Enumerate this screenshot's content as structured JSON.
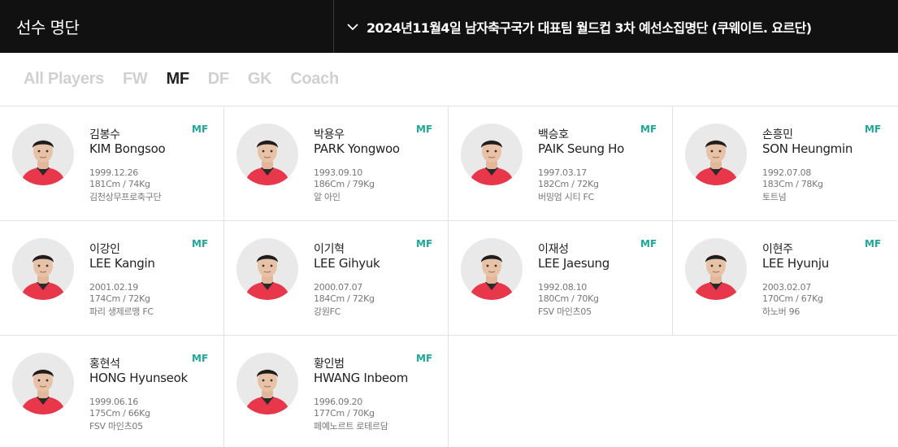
{
  "header": {
    "title": "선수 명단",
    "selection": "2024년11월4일 남자축구국가 대표팀 월드컵 3차 예선소집명단 (쿠웨이트. 요르단)"
  },
  "filters": [
    {
      "label": "All Players",
      "active": false
    },
    {
      "label": "FW",
      "active": false
    },
    {
      "label": "MF",
      "active": true
    },
    {
      "label": "DF",
      "active": false
    },
    {
      "label": "GK",
      "active": false
    },
    {
      "label": "Coach",
      "active": false
    }
  ],
  "players": [
    {
      "name_ko": "김봉수",
      "name_en": "KIM Bongsoo",
      "position": "MF",
      "dob": "1999.12.26",
      "height_weight": "181Cm / 74Kg",
      "club": "김천상무프로축구단"
    },
    {
      "name_ko": "박용우",
      "name_en": "PARK Yongwoo",
      "position": "MF",
      "dob": "1993.09.10",
      "height_weight": "186Cm / 79Kg",
      "club": "알 아인"
    },
    {
      "name_ko": "백승호",
      "name_en": "PAIK Seung Ho",
      "position": "MF",
      "dob": "1997.03.17",
      "height_weight": "182Cm / 72Kg",
      "club": "버밍엄 시티 FC"
    },
    {
      "name_ko": "손흥민",
      "name_en": "SON Heungmin",
      "position": "MF",
      "dob": "1992.07.08",
      "height_weight": "183Cm / 78Kg",
      "club": "토트넘"
    },
    {
      "name_ko": "이강인",
      "name_en": "LEE Kangin",
      "position": "MF",
      "dob": "2001.02.19",
      "height_weight": "174Cm / 72Kg",
      "club": "파리 생제르맹 FC"
    },
    {
      "name_ko": "이기혁",
      "name_en": "LEE Gihyuk",
      "position": "MF",
      "dob": "2000.07.07",
      "height_weight": "184Cm / 72Kg",
      "club": "강원FC"
    },
    {
      "name_ko": "이재성",
      "name_en": "LEE Jaesung",
      "position": "MF",
      "dob": "1992.08.10",
      "height_weight": "180Cm / 70Kg",
      "club": "FSV 마인츠05"
    },
    {
      "name_ko": "이현주",
      "name_en": "LEE Hyunju",
      "position": "MF",
      "dob": "2003.02.07",
      "height_weight": "170Cm / 67Kg",
      "club": "하노버 96"
    },
    {
      "name_ko": "홍현석",
      "name_en": "HONG Hyunseok",
      "position": "MF",
      "dob": "1999.06.16",
      "height_weight": "175Cm / 66Kg",
      "club": "FSV 마인츠05"
    },
    {
      "name_ko": "황인범",
      "name_en": "HWANG Inbeom",
      "position": "MF",
      "dob": "1996.09.20",
      "height_weight": "177Cm / 70Kg",
      "club": "페예노르트 로테르담"
    }
  ],
  "colors": {
    "header_bg": "#111111",
    "accent": "#1ea79a",
    "jersey": "#e8364a"
  },
  "icons": {
    "dropdown": "chevron-down-icon"
  }
}
